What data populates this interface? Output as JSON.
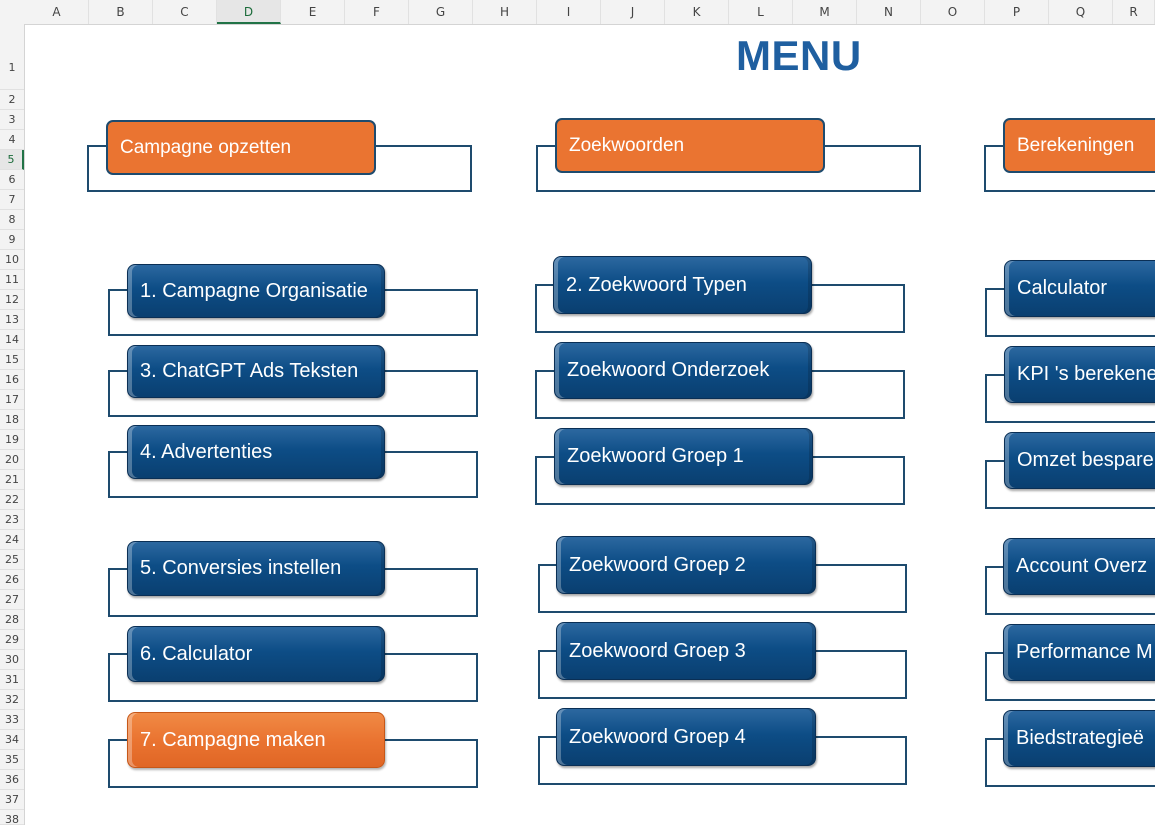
{
  "sheet": {
    "columns": [
      "A",
      "B",
      "C",
      "D",
      "E",
      "F",
      "G",
      "H",
      "I",
      "J",
      "K",
      "L",
      "M",
      "N",
      "O",
      "P",
      "Q",
      "R"
    ],
    "selected_column": "D",
    "rows": [
      "1",
      "2",
      "3",
      "4",
      "5",
      "6",
      "7",
      "8",
      "9",
      "10",
      "11",
      "12",
      "13",
      "14",
      "15",
      "16",
      "17",
      "18",
      "19",
      "20",
      "21",
      "22",
      "23",
      "24",
      "25",
      "26",
      "27",
      "28",
      "29",
      "30",
      "31",
      "32",
      "33",
      "34",
      "35",
      "36",
      "37",
      "38"
    ],
    "selected_row": "5"
  },
  "menu": {
    "title": "MENU",
    "sections": [
      {
        "header": "Campagne opzetten",
        "items": [
          {
            "label": "1. Campagne Organisatie",
            "color": "blue"
          },
          {
            "label": "3. ChatGPT Ads Teksten",
            "color": "blue"
          },
          {
            "label": "4. Advertenties",
            "color": "blue"
          },
          {
            "label": "5. Conversies instellen",
            "color": "blue"
          },
          {
            "label": "6. Calculator",
            "color": "blue"
          },
          {
            "label": "7. Campagne maken",
            "color": "orange"
          }
        ]
      },
      {
        "header": "Zoekwoorden",
        "items": [
          {
            "label": "2. Zoekwoord Typen",
            "color": "blue"
          },
          {
            "label": "Zoekwoord Onderzoek",
            "color": "blue"
          },
          {
            "label": "Zoekwoord Groep 1",
            "color": "blue"
          },
          {
            "label": "Zoekwoord Groep 2",
            "color": "blue"
          },
          {
            "label": "Zoekwoord Groep 3",
            "color": "blue"
          },
          {
            "label": "Zoekwoord Groep 4",
            "color": "blue"
          }
        ]
      },
      {
        "header": "Berekeningen",
        "items": [
          {
            "label": "Calculator",
            "color": "blue"
          },
          {
            "label": "KPI 's berekene",
            "color": "blue"
          },
          {
            "label": "Omzet bespare",
            "color": "blue"
          },
          {
            "label": "Account Overz",
            "color": "blue"
          },
          {
            "label": "Performance M",
            "color": "blue"
          },
          {
            "label": "Biedstrategieë",
            "color": "blue"
          }
        ]
      }
    ]
  },
  "colors": {
    "blue_button": "#0d4d86",
    "orange_button": "#ea7431",
    "title": "#1f5fa0",
    "frame": "#1e4b6e"
  }
}
